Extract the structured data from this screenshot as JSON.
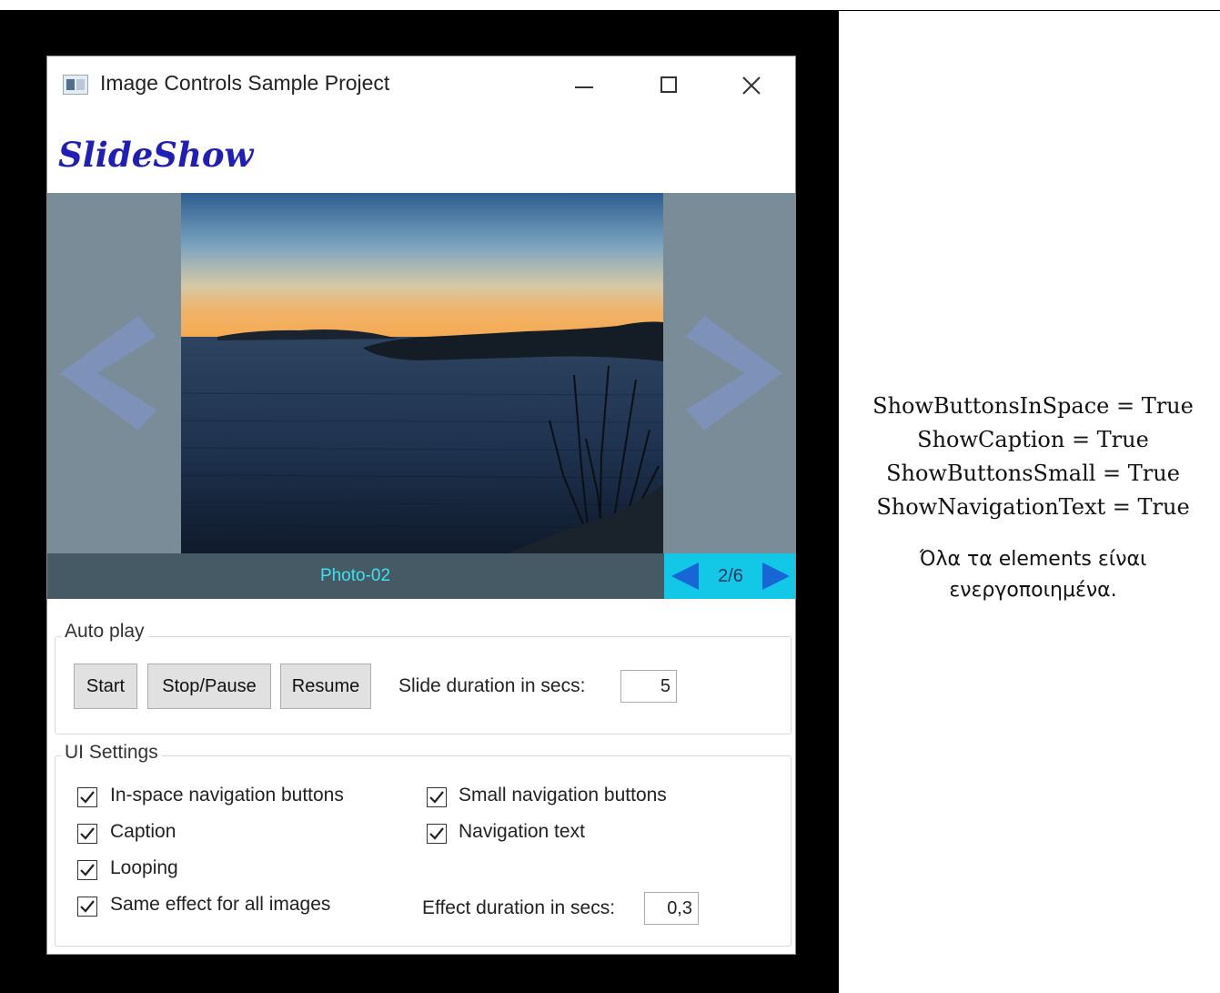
{
  "window": {
    "title": "Image Controls Sample Project"
  },
  "heading": "SlideShow",
  "slideshow": {
    "caption": "Photo-02",
    "counter": "2/6"
  },
  "auto_play": {
    "legend": "Auto play",
    "start_label": "Start",
    "stop_label": "Stop/Pause",
    "resume_label": "Resume",
    "duration_label": "Slide duration in secs:",
    "duration_value": "5"
  },
  "ui_settings": {
    "legend": "UI Settings",
    "checkboxes": [
      {
        "label": "In-space navigation buttons",
        "checked": true
      },
      {
        "label": "Small navigation buttons",
        "checked": true
      },
      {
        "label": "Caption",
        "checked": true
      },
      {
        "label": "Navigation text",
        "checked": true
      },
      {
        "label": "Looping",
        "checked": true
      },
      {
        "label": "Same effect for all images",
        "checked": true
      }
    ],
    "effect_label": "Effect duration in secs:",
    "effect_value": "0,3"
  },
  "notes": {
    "lines": [
      "ShowButtonsInSpace = True",
      "ShowCaption = True",
      "ShowButtonsSmall = True",
      "ShowNavigationText = True"
    ],
    "greek_line1": "Όλα τα elements είναι",
    "greek_line2": "ενεργοποιημένα."
  },
  "colors": {
    "heading": "#1f1fb8",
    "slide_bg": "#7a8c97",
    "caption_bar": "#465a66",
    "caption_text": "#3fe0f0",
    "nav_box": "#13c8e6",
    "nav_arrow": "#1866d6"
  }
}
